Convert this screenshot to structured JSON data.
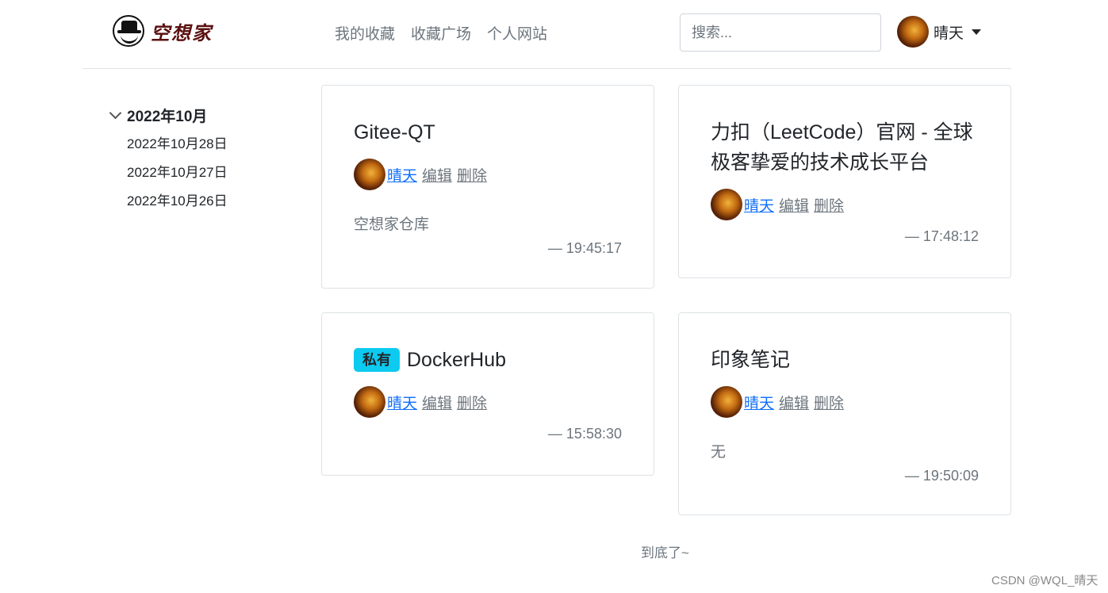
{
  "header": {
    "brand_name": "空想家",
    "nav": [
      "我的收藏",
      "收藏广场",
      "个人网站"
    ],
    "search_placeholder": "搜索...",
    "user_name": "晴天"
  },
  "sidebar": {
    "month": "2022年10月",
    "days": [
      "2022年10月28日",
      "2022年10月27日",
      "2022年10月26日"
    ]
  },
  "cards": [
    {
      "badge": "",
      "title": "Gitee-QT",
      "author": "晴天",
      "edit": "编辑",
      "delete": "删除",
      "desc": "空想家仓库",
      "time": "— 19:45:17"
    },
    {
      "badge": "",
      "title": "力扣（LeetCode）官网 - 全球极客挚爱的技术成长平台",
      "author": "晴天",
      "edit": "编辑",
      "delete": "删除",
      "desc": "",
      "time": "— 17:48:12"
    },
    {
      "badge": "私有",
      "title": "DockerHub",
      "author": "晴天",
      "edit": "编辑",
      "delete": "删除",
      "desc": "",
      "time": "— 15:58:30"
    },
    {
      "badge": "",
      "title": "印象笔记",
      "author": "晴天",
      "edit": "编辑",
      "delete": "删除",
      "desc": "无",
      "time": "— 19:50:09"
    }
  ],
  "footer": {
    "end_note": "到底了~",
    "watermark": "CSDN @WQL_晴天"
  },
  "colors": {
    "badge": "#0dcaf0",
    "author_link": "#0d6efd",
    "muted": "#6c757d"
  }
}
